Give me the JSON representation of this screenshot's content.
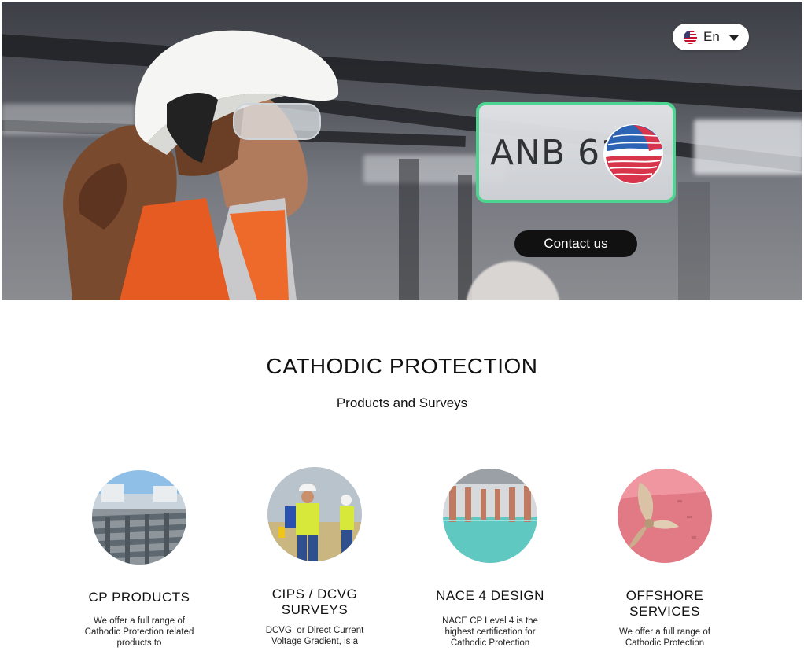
{
  "language": {
    "code": "En",
    "flag_icon": "us-flag-icon"
  },
  "logo": {
    "text": "ANB 61"
  },
  "hero": {
    "cta_label": "Contact us"
  },
  "section": {
    "title": "CATHODIC PROTECTION",
    "subtitle": "Products and Surveys"
  },
  "cards": [
    {
      "title": "CP PRODUCTS",
      "description": "We offer a full range of Cathodic Protection related products to"
    },
    {
      "title": "CIPS / DCVG\nSURVEYS",
      "description": "DCVG, or Direct Current Voltage Gradient, is a"
    },
    {
      "title": "NACE 4 DESIGN",
      "description": "NACE CP Level 4 is the highest certification for Cathodic Protection"
    },
    {
      "title": "OFFSHORE\nSERVICES",
      "description": "We offer a full range of Cathodic Protection"
    }
  ],
  "colors": {
    "accent_border": "#4cd491",
    "button_bg": "#111111"
  }
}
